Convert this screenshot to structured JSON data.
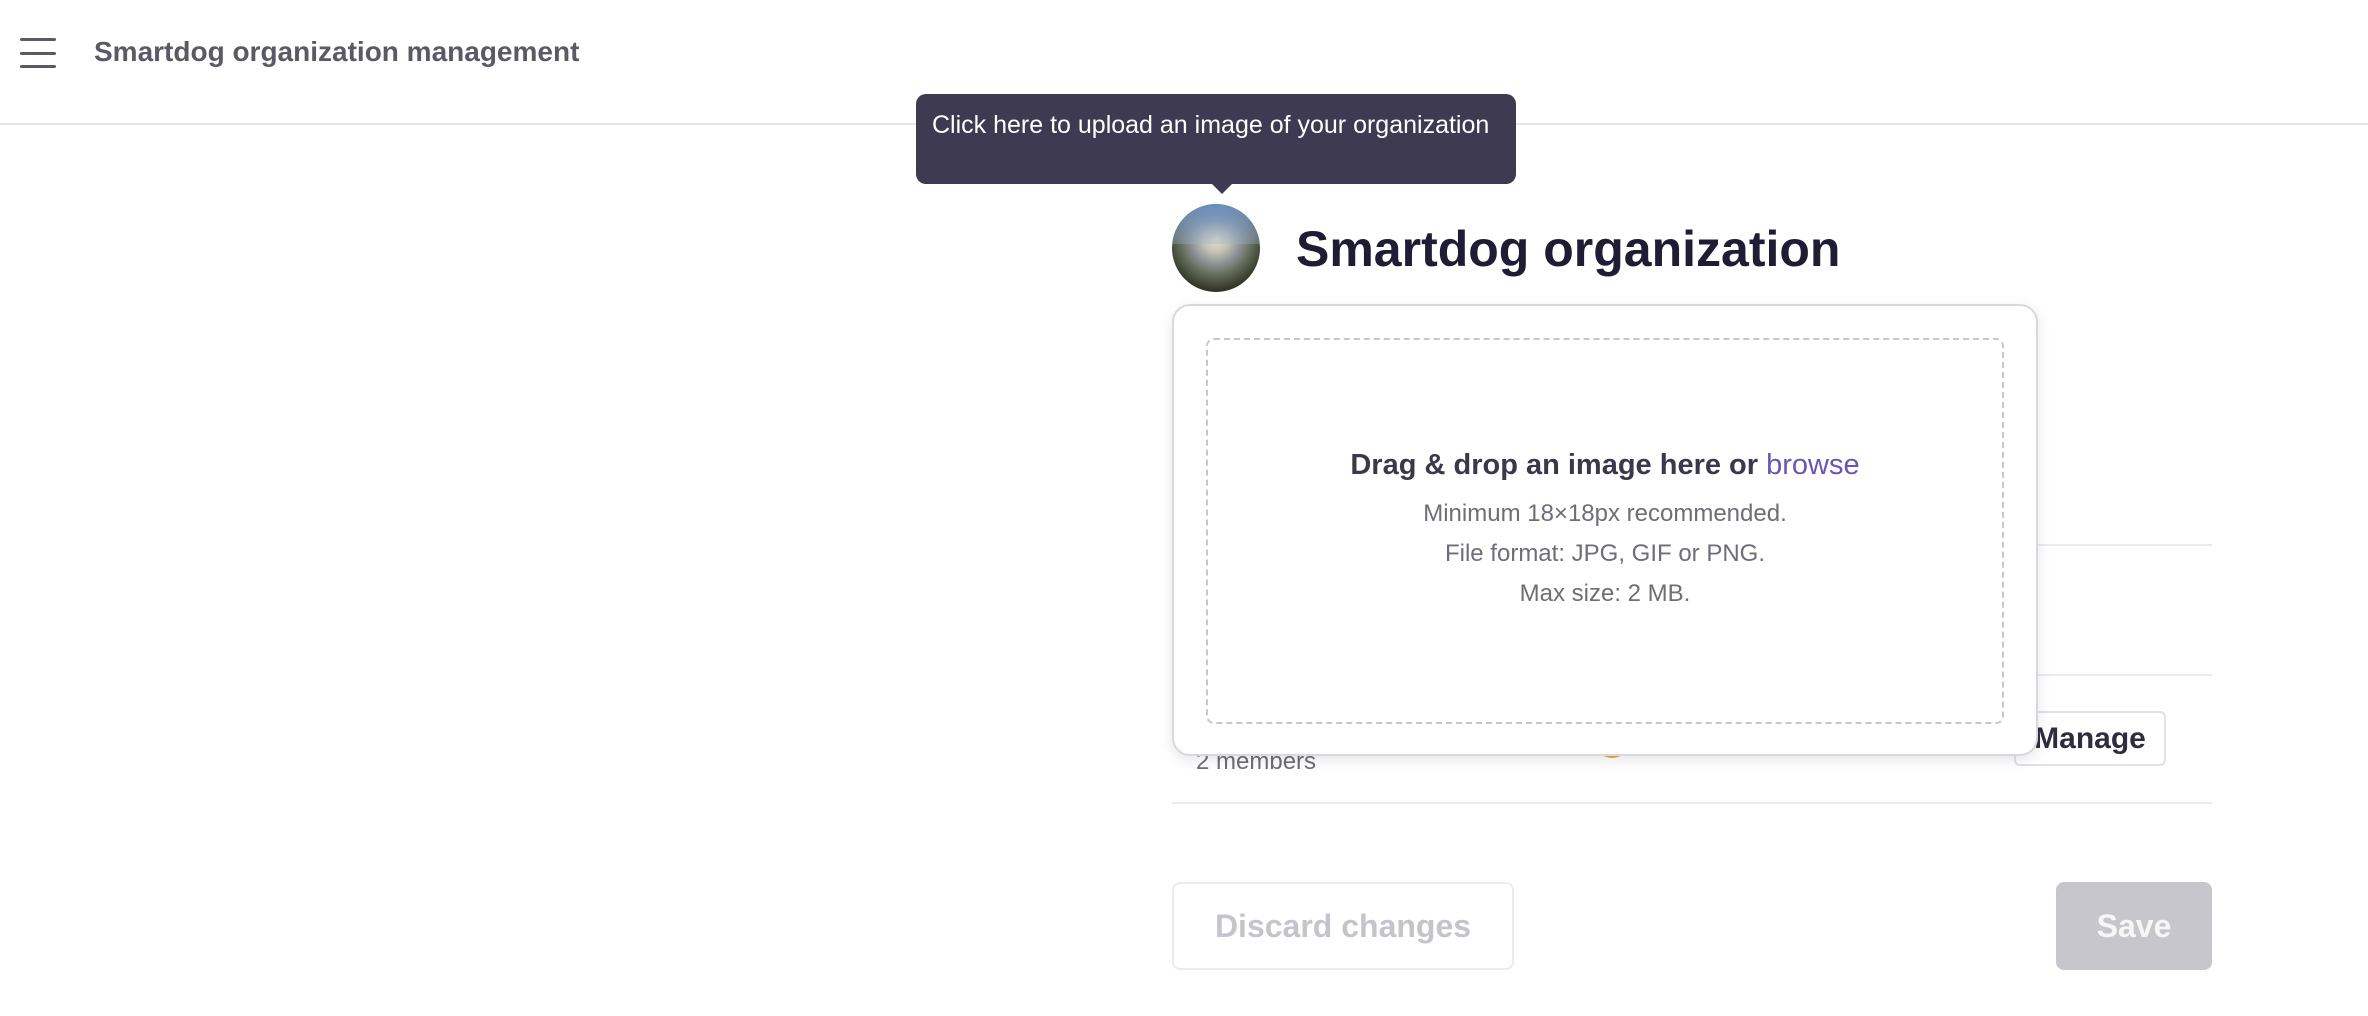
{
  "header": {
    "menu_icon": "hamburger-menu-icon",
    "title": "Smartdog organization management"
  },
  "tooltip": {
    "text": "Click here to upload an image of your organization"
  },
  "organization": {
    "name": "Smartdog organization",
    "members_count": "2 members"
  },
  "upload": {
    "title": "Drag & drop an image here or",
    "browse_label": "browse",
    "min_size": "Minimum 18×18px recommended.",
    "file_format": "File format: JPG, GIF or PNG.",
    "max_size": "Max size: 2 MB."
  },
  "actions": {
    "manage_label": "Manage",
    "discard_label": "Discard changes",
    "save_label": "Save"
  },
  "colors": {
    "tooltip_bg": "#3d3a51",
    "link": "#6a55b6",
    "save_disabled": "#c6c6cc"
  }
}
